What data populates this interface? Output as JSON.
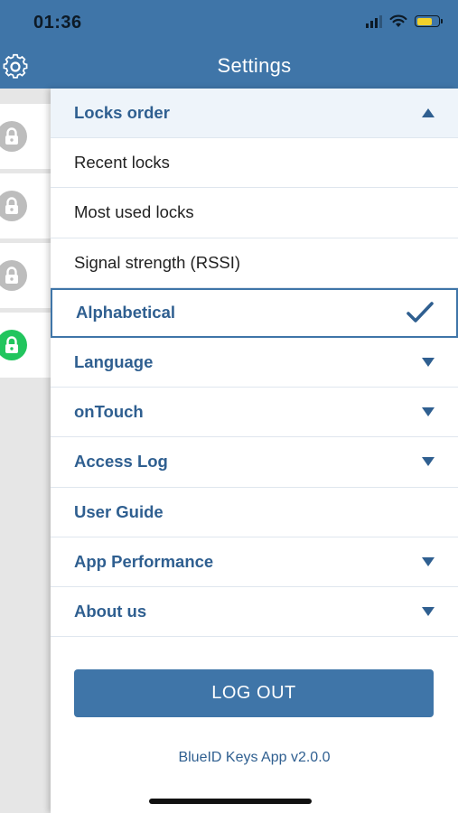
{
  "status_bar": {
    "time": "01:36",
    "signal_icon": "cellular-signal-icon",
    "wifi_icon": "wifi-icon",
    "battery_icon": "battery-icon",
    "battery_color": "#f2d12a"
  },
  "header": {
    "title": "Settings",
    "menu_icon": "gear-icon",
    "color": "#3f75a8"
  },
  "lock_list": {
    "items": [
      {
        "icon": "lock-icon",
        "state": "inactive"
      },
      {
        "icon": "lock-icon",
        "state": "inactive"
      },
      {
        "icon": "lock-icon",
        "state": "inactive"
      },
      {
        "icon": "lock-icon",
        "state": "active"
      }
    ],
    "active_color": "#22c55e",
    "inactive_color": "#bdbdbd"
  },
  "settings": {
    "locks_order": {
      "label": "Locks order",
      "expanded": true,
      "options": [
        {
          "label": "Recent locks",
          "selected": false
        },
        {
          "label": "Most used locks",
          "selected": false
        },
        {
          "label": "Signal strength (RSSI)",
          "selected": false
        },
        {
          "label": "Alphabetical",
          "selected": true
        }
      ]
    },
    "sections": [
      {
        "label": "Language",
        "expandable": true
      },
      {
        "label": "onTouch",
        "expandable": true
      },
      {
        "label": "Access Log",
        "expandable": true
      },
      {
        "label": "User Guide",
        "expandable": false
      },
      {
        "label": "App Performance",
        "expandable": true
      },
      {
        "label": "About us",
        "expandable": true
      }
    ]
  },
  "logout_label": "LOG OUT",
  "version_text": "BlueID Keys App v2.0.0"
}
